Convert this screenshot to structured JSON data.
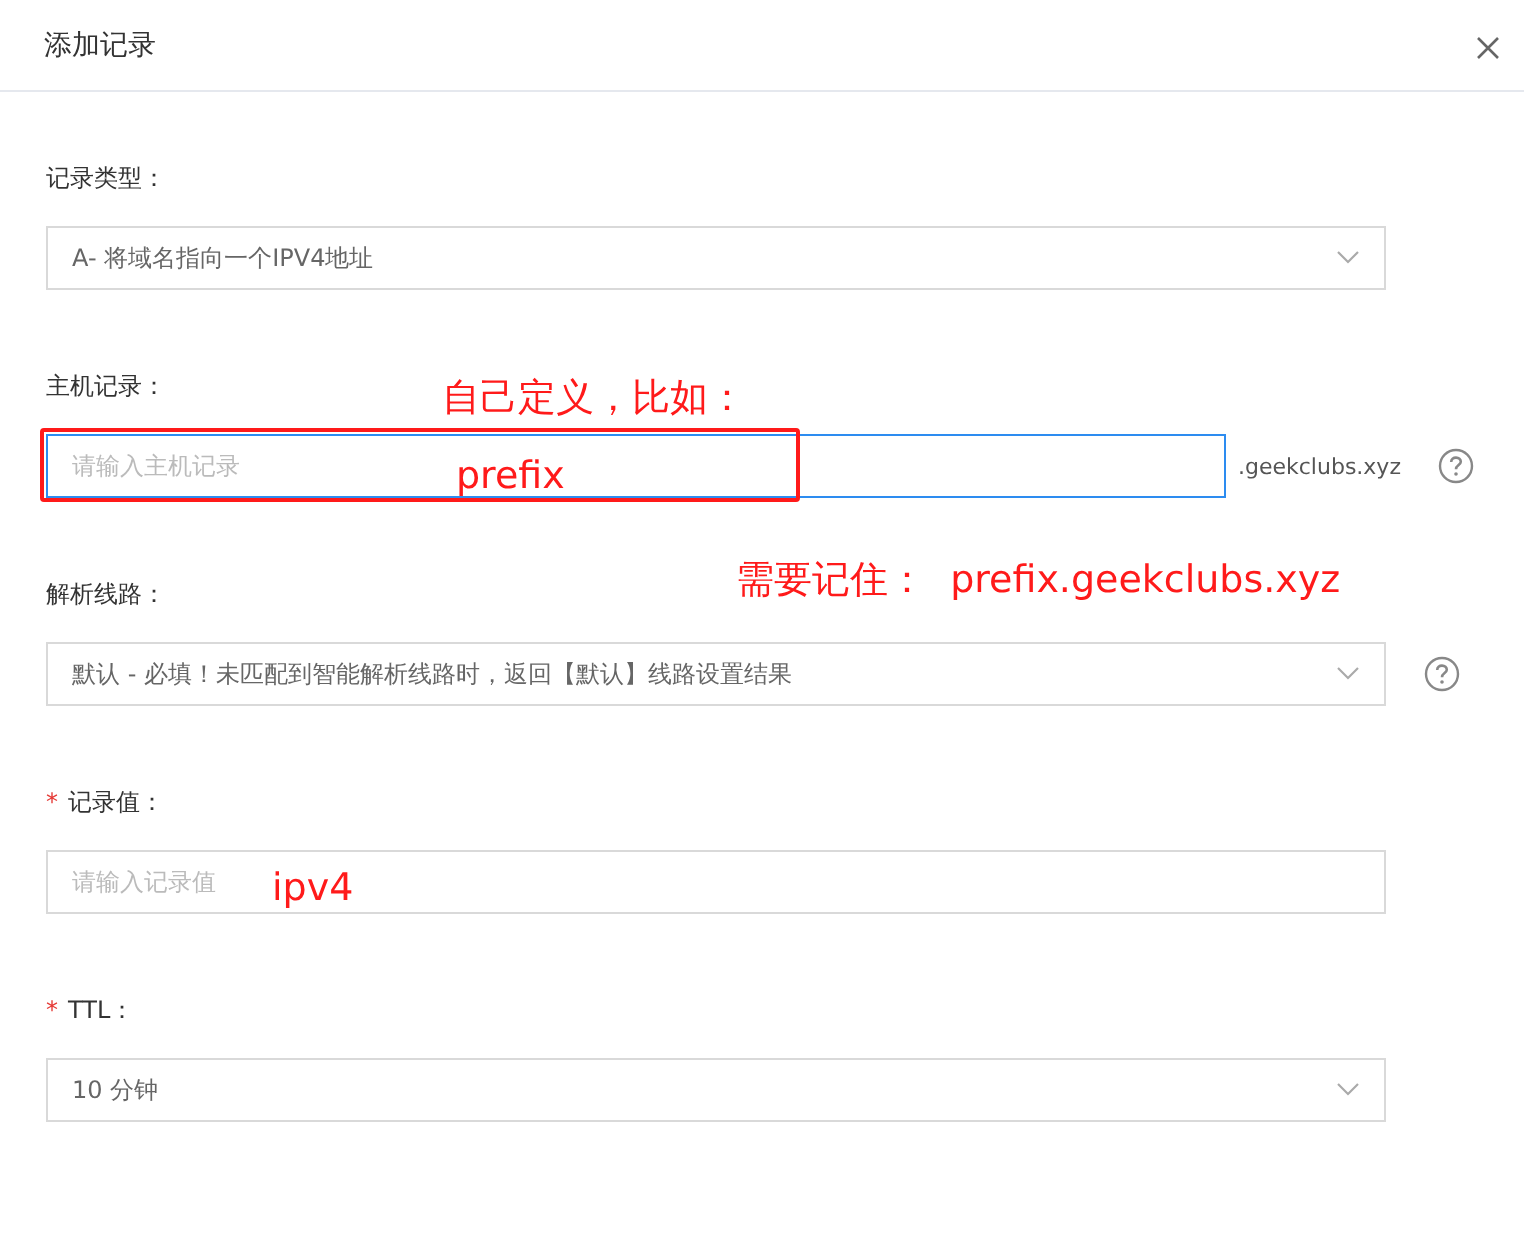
{
  "dialog": {
    "title": "添加记录"
  },
  "fields": [
    {
      "kind": "select",
      "label": "记录类型：",
      "value": "A- 将域名指向一个IPV4地址",
      "help": false
    },
    {
      "kind": "input",
      "label": "主机记录：",
      "placeholder": "请输入主机记录",
      "focused": true,
      "suffix": ".geekclubs.xyz",
      "help": true
    },
    {
      "kind": "select",
      "label": "解析线路：",
      "value": "默认 - 必填！未匹配到智能解析线路时，返回【默认】线路设置结果",
      "help": true
    },
    {
      "kind": "input",
      "label": "记录值：",
      "required_mark": "*",
      "placeholder": "请输入记录值",
      "focused": false,
      "help": false
    },
    {
      "kind": "select",
      "label": "TTL：",
      "required_mark": "*",
      "value": "10 分钟",
      "help": false
    }
  ],
  "annotations": [
    {
      "text": "自己定义，比如："
    },
    {
      "text": "prefix"
    },
    {
      "text": "需要记住：  prefix.geekclubs.xyz"
    },
    {
      "text": "ipv4"
    }
  ]
}
